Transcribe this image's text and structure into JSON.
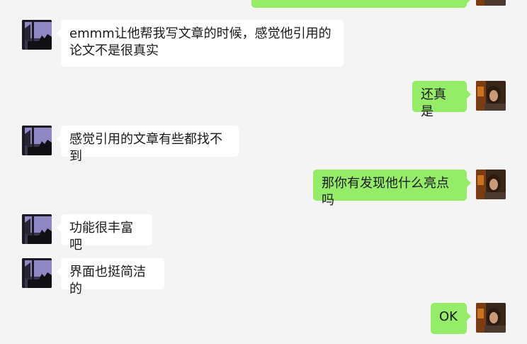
{
  "chat": {
    "messages": [
      {
        "sender": "me",
        "text": ""
      },
      {
        "sender": "other",
        "text": "emmm让他帮我写文章的时候，感觉他引用的论文不是很真实"
      },
      {
        "sender": "me",
        "text": "还真是"
      },
      {
        "sender": "other",
        "text": "感觉引用的文章有些都找不到"
      },
      {
        "sender": "me",
        "text": "那你有发现他什么亮点吗"
      },
      {
        "sender": "other",
        "text": "功能很丰富吧"
      },
      {
        "sender": "other",
        "text": "界面也挺简洁的"
      },
      {
        "sender": "me",
        "text": "OK"
      }
    ]
  },
  "colors": {
    "background": "#f4f4f4",
    "incoming_bubble": "#ffffff",
    "outgoing_bubble": "#95ec69",
    "text": "#191919"
  },
  "icons": {
    "other_avatar": "window-silhouette-avatar-icon",
    "my_avatar": "person-portrait-avatar-icon"
  }
}
